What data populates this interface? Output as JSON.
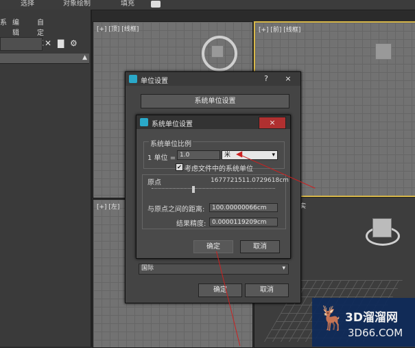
{
  "ribbon": {
    "items": [
      "选择",
      "对象绘制",
      "填充"
    ]
  },
  "command_panel": {
    "menu": [
      "系",
      "编辑",
      "自定义"
    ],
    "list_arrow": "▲"
  },
  "viewports": {
    "top": "[+] [顶] [线框]",
    "front": "[+] [前] [线框]",
    "left": "[+] [左]",
    "persp_fragment": "实"
  },
  "units_dialog": {
    "title": "单位设置",
    "help": "?",
    "close": "×",
    "system_units_button": "系统单位设置",
    "display_dropdown": "国际",
    "ok": "确定",
    "cancel": "取消"
  },
  "system_units_dialog": {
    "title": "系统单位设置",
    "close": "×",
    "group_label": "系统单位比例",
    "unit_label": "1 单位 =",
    "unit_value": "1.0",
    "unit_select": "米",
    "consider_files_label": "考虑文件中的系统单位",
    "consider_files_checked": true,
    "origin_label": "原点",
    "origin_value": "1677721511.0729618cm",
    "distance_label": "与原点之间的距离:",
    "distance_value": "100.00000066cm",
    "precision_label": "结果精度:",
    "precision_value": "0.0000119209cm",
    "ok": "确定",
    "cancel": "取消"
  },
  "watermark": {
    "brand": "3D溜溜网",
    "url": "3D66.COM"
  },
  "colors": {
    "accent_arrow": "#cc2020",
    "active_viewport": "#d8b84a",
    "app_icon": "#2aa9c9"
  }
}
